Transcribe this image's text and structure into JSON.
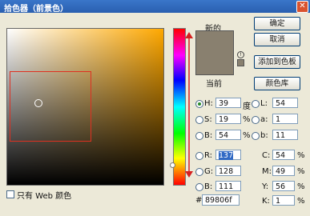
{
  "window": {
    "title": "拾色器（前景色）",
    "close": "✕"
  },
  "preview": {
    "new_label": "新的",
    "current_label": "当前",
    "color": "#89806f"
  },
  "buttons": {
    "ok": "确定",
    "cancel": "取消",
    "add_swatches": "添加到色板",
    "color_libraries": "颜色库"
  },
  "hsb": {
    "h": {
      "label": "H:",
      "value": "39",
      "unit": "度"
    },
    "s": {
      "label": "S:",
      "value": "19",
      "unit": "%"
    },
    "b": {
      "label": "B:",
      "value": "54",
      "unit": "%"
    }
  },
  "rgb": {
    "r": {
      "label": "R:",
      "value": "137"
    },
    "g": {
      "label": "G:",
      "value": "128"
    },
    "b": {
      "label": "B:",
      "value": "111"
    }
  },
  "lab": {
    "l": {
      "label": "L:",
      "value": "54"
    },
    "a": {
      "label": "a:",
      "value": "1"
    },
    "b": {
      "label": "b:",
      "value": "11"
    }
  },
  "cmyk": {
    "c": {
      "label": "C:",
      "value": "54",
      "unit": "%"
    },
    "m": {
      "label": "M:",
      "value": "49",
      "unit": "%"
    },
    "y": {
      "label": "Y:",
      "value": "56",
      "unit": "%"
    },
    "k": {
      "label": "K:",
      "value": "1",
      "unit": "%"
    }
  },
  "hex": {
    "prefix": "#",
    "value": "89806f"
  },
  "web_only": {
    "label": "只有 Web 颜色",
    "checked": false
  },
  "selected_mode": "H"
}
